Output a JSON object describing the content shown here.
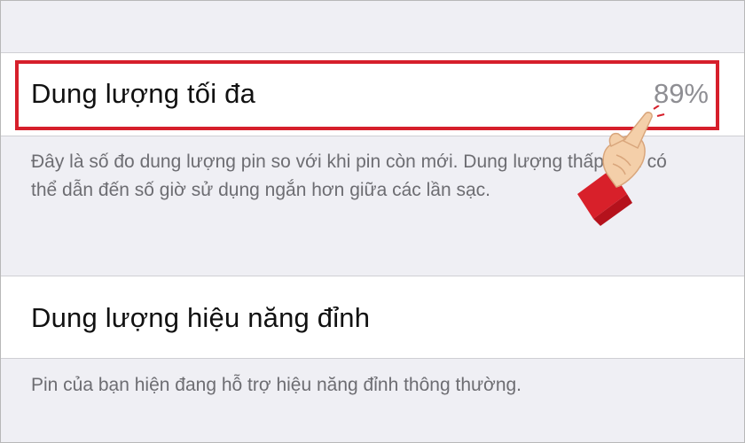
{
  "battery_health": {
    "maximum_capacity": {
      "label": "Dung lượng tối đa",
      "value": "89%",
      "description": "Đây là số đo dung lượng pin so với khi pin còn mới. Dung lượng thấp hơn có thể dẫn đến số giờ sử dụng ngắn hơn giữa các lần sạc."
    },
    "peak_performance": {
      "label": "Dung lượng hiệu năng đỉnh",
      "description": "Pin của bạn hiện đang hỗ trợ hiệu năng đỉnh thông thường."
    }
  },
  "colors": {
    "highlight": "#d61f2b",
    "background": "#efeff4",
    "secondary_text": "#6d6d72"
  },
  "icons": {
    "pointer": "pointing-hand-icon"
  }
}
